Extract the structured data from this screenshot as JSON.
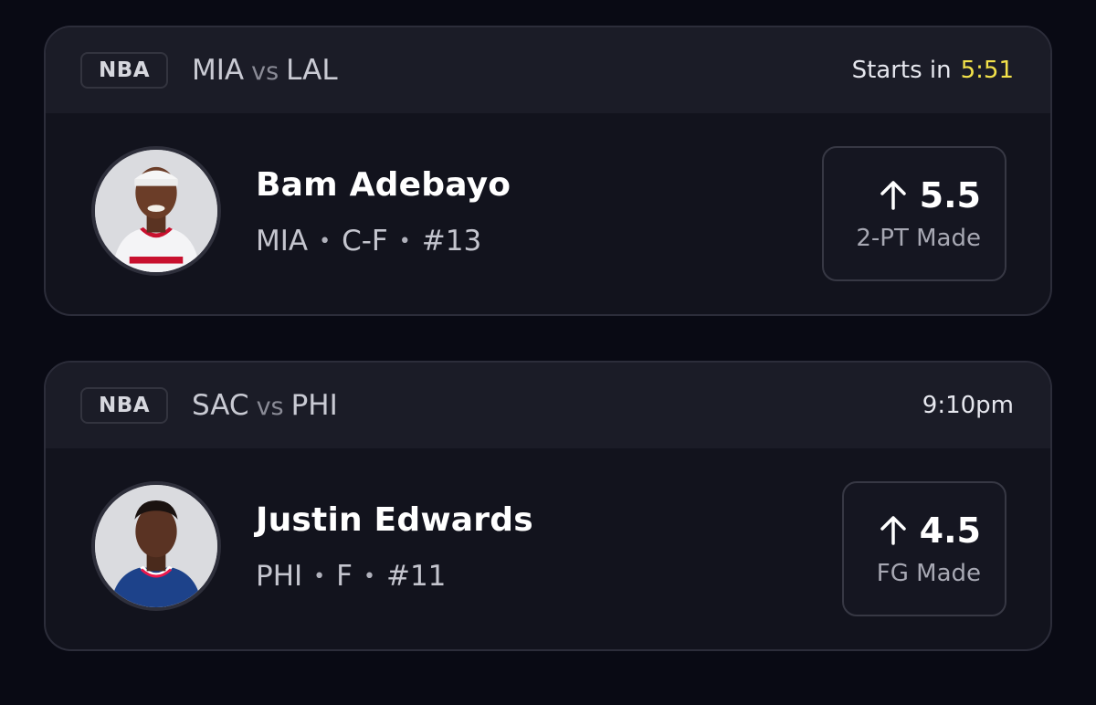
{
  "cards": [
    {
      "league": "NBA",
      "home": "MIA",
      "vs": "vs",
      "away": "LAL",
      "start_prefix": "Starts in",
      "start_timer": "5:51",
      "player": {
        "name": "Bam Adebayo",
        "team": "MIA",
        "position": "C-F",
        "number": "#13",
        "jersey_color": "#f4f4f6",
        "trim_color": "#c8102e"
      },
      "prop": {
        "direction_icon": "arrow-up-icon",
        "line": "5.5",
        "stat": "2-PT Made"
      }
    },
    {
      "league": "NBA",
      "home": "SAC",
      "vs": "vs",
      "away": "PHI",
      "start_time": "9:10pm",
      "player": {
        "name": "Justin Edwards",
        "team": "PHI",
        "position": "F",
        "number": "#11",
        "jersey_color": "#1d428a",
        "trim_color": "#ed174c"
      },
      "prop": {
        "direction_icon": "arrow-up-icon",
        "line": "4.5",
        "stat": "FG Made"
      }
    }
  ],
  "separator": "•",
  "colors": {
    "background": "#090a14",
    "card": "#12131d",
    "header": "#1b1c27",
    "timer_accent": "#f2e14a"
  }
}
